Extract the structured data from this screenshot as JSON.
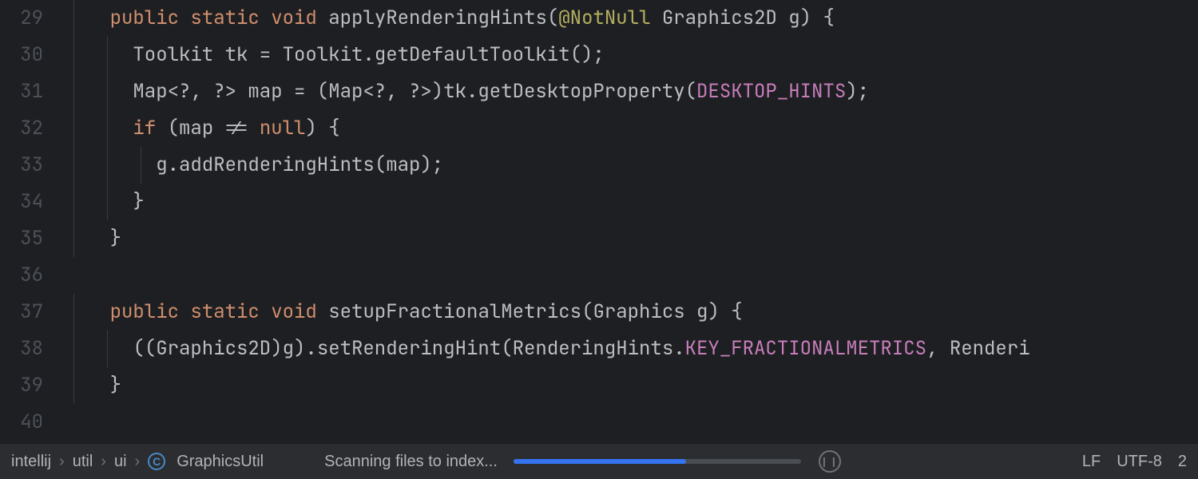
{
  "editor": {
    "lines": [
      {
        "num": "29",
        "guides": [
          20
        ],
        "tokens": [
          {
            "t": "    ",
            "c": "txt"
          },
          {
            "t": "public",
            "c": "kw"
          },
          {
            "t": " ",
            "c": "txt"
          },
          {
            "t": "static",
            "c": "kw"
          },
          {
            "t": " ",
            "c": "txt"
          },
          {
            "t": "void",
            "c": "kw"
          },
          {
            "t": " ",
            "c": "txt"
          },
          {
            "t": "applyRenderingHints",
            "c": "mth"
          },
          {
            "t": "(",
            "c": "pun"
          },
          {
            "t": "@NotNull",
            "c": "ann"
          },
          {
            "t": " Graphics2D g) {",
            "c": "txt"
          }
        ]
      },
      {
        "num": "30",
        "guides": [
          20,
          62
        ],
        "tokens": [
          {
            "t": "      Toolkit tk = Toolkit.",
            "c": "txt"
          },
          {
            "t": "getDefaultToolkit",
            "c": "call"
          },
          {
            "t": "();",
            "c": "pun"
          }
        ]
      },
      {
        "num": "31",
        "guides": [
          20,
          62
        ],
        "tokens": [
          {
            "t": "      Map<?, ?> map = (Map<?, ?>)tk.",
            "c": "txt"
          },
          {
            "t": "getDesktopProperty",
            "c": "call"
          },
          {
            "t": "(",
            "c": "pun"
          },
          {
            "t": "DESKTOP_HINTS",
            "c": "fld"
          },
          {
            "t": ");",
            "c": "pun"
          }
        ]
      },
      {
        "num": "32",
        "guides": [
          20,
          62
        ],
        "tokens": [
          {
            "t": "      ",
            "c": "txt"
          },
          {
            "t": "if",
            "c": "kw"
          },
          {
            "t": " (map != ",
            "c": "txt"
          },
          {
            "t": "null",
            "c": "kw"
          },
          {
            "t": ") {",
            "c": "txt"
          }
        ]
      },
      {
        "num": "33",
        "guides": [
          20,
          62,
          104
        ],
        "tokens": [
          {
            "t": "        g.",
            "c": "txt"
          },
          {
            "t": "addRenderingHints",
            "c": "call"
          },
          {
            "t": "(map);",
            "c": "txt"
          }
        ]
      },
      {
        "num": "34",
        "guides": [
          20,
          62
        ],
        "tokens": [
          {
            "t": "      }",
            "c": "txt"
          }
        ]
      },
      {
        "num": "35",
        "guides": [
          20
        ],
        "tokens": [
          {
            "t": "    }",
            "c": "txt"
          }
        ]
      },
      {
        "num": "36",
        "guides": [],
        "tokens": [
          {
            "t": "",
            "c": "txt"
          }
        ]
      },
      {
        "num": "37",
        "guides": [
          20
        ],
        "tokens": [
          {
            "t": "    ",
            "c": "txt"
          },
          {
            "t": "public",
            "c": "kw"
          },
          {
            "t": " ",
            "c": "txt"
          },
          {
            "t": "static",
            "c": "kw"
          },
          {
            "t": " ",
            "c": "txt"
          },
          {
            "t": "void",
            "c": "kw"
          },
          {
            "t": " ",
            "c": "txt"
          },
          {
            "t": "setupFractionalMetrics",
            "c": "mth"
          },
          {
            "t": "(Graphics g) {",
            "c": "txt"
          }
        ]
      },
      {
        "num": "38",
        "guides": [
          20,
          62
        ],
        "tokens": [
          {
            "t": "      ((Graphics2D)g).",
            "c": "txt"
          },
          {
            "t": "setRenderingHint",
            "c": "call"
          },
          {
            "t": "(RenderingHints.",
            "c": "txt"
          },
          {
            "t": "KEY_FRACTIONALMETRICS",
            "c": "fld"
          },
          {
            "t": ", Renderi",
            "c": "txt"
          }
        ]
      },
      {
        "num": "39",
        "guides": [
          20
        ],
        "tokens": [
          {
            "t": "    }",
            "c": "txt"
          }
        ]
      },
      {
        "num": "40",
        "guides": [],
        "tokens": [
          {
            "t": "",
            "c": "txt"
          }
        ]
      }
    ]
  },
  "statusbar": {
    "breadcrumbs": [
      "intellij",
      "util",
      "ui"
    ],
    "class_icon_letter": "C",
    "class_name": "GraphicsUtil",
    "status_text": "Scanning files to index...",
    "progress_percent": 60,
    "line_sep": "LF",
    "encoding": "UTF-8",
    "indent": "2"
  }
}
